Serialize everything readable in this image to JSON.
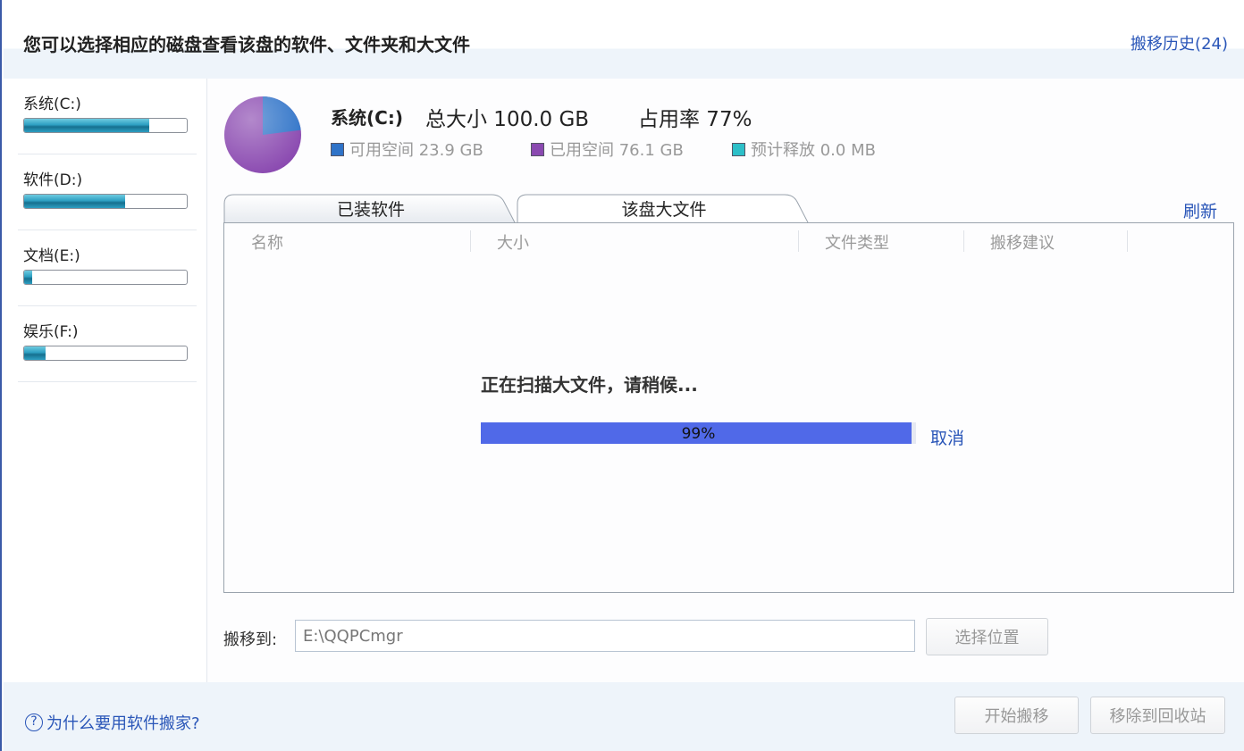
{
  "header": {
    "title": "您可以选择相应的磁盘查看该盘的软件、文件夹和大文件",
    "history_link": "搬移历史(24)"
  },
  "drives": [
    {
      "label": "系统(C:)",
      "usage": 0.77
    },
    {
      "label": "软件(D:)",
      "usage": 0.62
    },
    {
      "label": "文档(E:)",
      "usage": 0.05
    },
    {
      "label": "娱乐(F:)",
      "usage": 0.13
    }
  ],
  "disk_summary": {
    "name": "系统(C:)",
    "total": "总大小 100.0 GB",
    "usage": "占用率 77%",
    "legend": [
      {
        "label": "可用空间 23.9 GB",
        "color": "#2f73c8"
      },
      {
        "label": "已用空间 76.1 GB",
        "color": "#8a49b0"
      },
      {
        "label": "预计释放 0.0 MB",
        "color": "#2dbfc8"
      }
    ]
  },
  "tabs": [
    {
      "label": "已装软件",
      "active": false
    },
    {
      "label": "该盘大文件",
      "active": true
    }
  ],
  "refresh_link": "刷新",
  "table": {
    "columns": [
      "名称",
      "大小",
      "文件类型",
      "搬移建议"
    ]
  },
  "scan": {
    "message": "正在扫描大文件，请稍候...",
    "progress": 0.99,
    "progress_label": "99%",
    "cancel": "取消"
  },
  "move_to": {
    "label": "搬移到:",
    "path": "E:\\QQPCmgr",
    "choose_button": "选择位置"
  },
  "footer": {
    "help_icon": "question-circle-icon",
    "help_text": "为什么要用软件搬家?",
    "start_button": "开始搬移",
    "recycle_button": "移除到回收站"
  }
}
